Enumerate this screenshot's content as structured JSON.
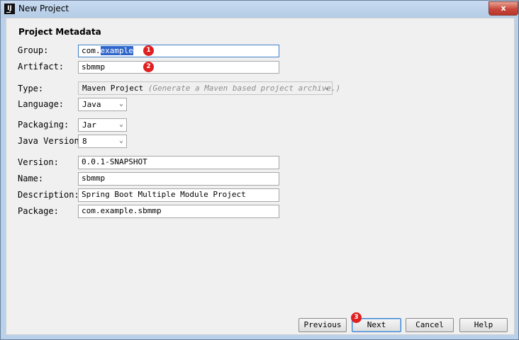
{
  "window": {
    "title": "New Project",
    "close_glyph": "x"
  },
  "section_title": "Project Metadata",
  "fields": {
    "group": {
      "label": "Group:",
      "prefix": "com.",
      "selected": "example"
    },
    "artifact": {
      "label": "Artifact:",
      "value": "sbmmp"
    },
    "type": {
      "label": "Type:",
      "value": "Maven Project",
      "hint": "(Generate a Maven based project archive.)"
    },
    "language": {
      "label": "Language:",
      "value": "Java"
    },
    "packaging": {
      "label": "Packaging:",
      "value": "Jar"
    },
    "java_version": {
      "label": "Java Version:",
      "value": "8"
    },
    "version": {
      "label": "Version:",
      "value": "0.0.1-SNAPSHOT"
    },
    "name": {
      "label": "Name:",
      "value": "sbmmp"
    },
    "description": {
      "label": "Description:",
      "value": "Spring Boot Multiple Module Project"
    },
    "package": {
      "label": "Package:",
      "value": "com.example.sbmmp"
    }
  },
  "badges": {
    "b1": "1",
    "b2": "2",
    "b3": "3"
  },
  "buttons": {
    "previous": "Previous",
    "next": "Next",
    "cancel": "Cancel",
    "help": "Help"
  },
  "icons": {
    "app": "intellij-idea-icon",
    "chevron": "chevron-down-icon"
  },
  "colors": {
    "selection": "#2f65ca",
    "badge": "#e02020",
    "focus": "#3d7fc9"
  }
}
